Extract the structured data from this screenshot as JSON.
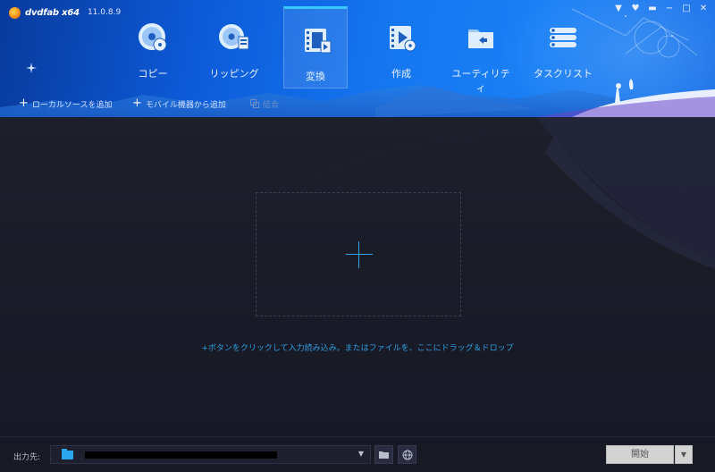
{
  "app": {
    "name": "dvdfab x64",
    "version": "11.0.8.9"
  },
  "window_controls": [
    "▼",
    "♥",
    "▬",
    "−",
    "□",
    "✕"
  ],
  "nav": [
    {
      "label": "コピー",
      "icon": "disc-copy-icon"
    },
    {
      "label": "リッピング",
      "icon": "disc-ripping-icon"
    },
    {
      "label": "変換",
      "icon": "film-convert-icon",
      "active": true
    },
    {
      "label": "作成",
      "icon": "film-create-icon"
    },
    {
      "label": "ユーティリティ",
      "icon": "utility-folder-icon"
    },
    {
      "label": "タスクリスト",
      "icon": "task-list-icon"
    }
  ],
  "subbar": {
    "add_local": "ローカルソースを追加",
    "add_mobile": "モバイル機器から追加",
    "merge": "結合"
  },
  "main": {
    "hint": "+ボタンをクリックして入力読み込み。またはファイルを、ここにドラッグ＆ドロップ"
  },
  "bottom": {
    "output_label": "出力先:",
    "start_label": "開始"
  },
  "colors": {
    "accent": "#2f9de0",
    "header_blue": "#1577f0",
    "bg_dark": "#1a1b26"
  }
}
